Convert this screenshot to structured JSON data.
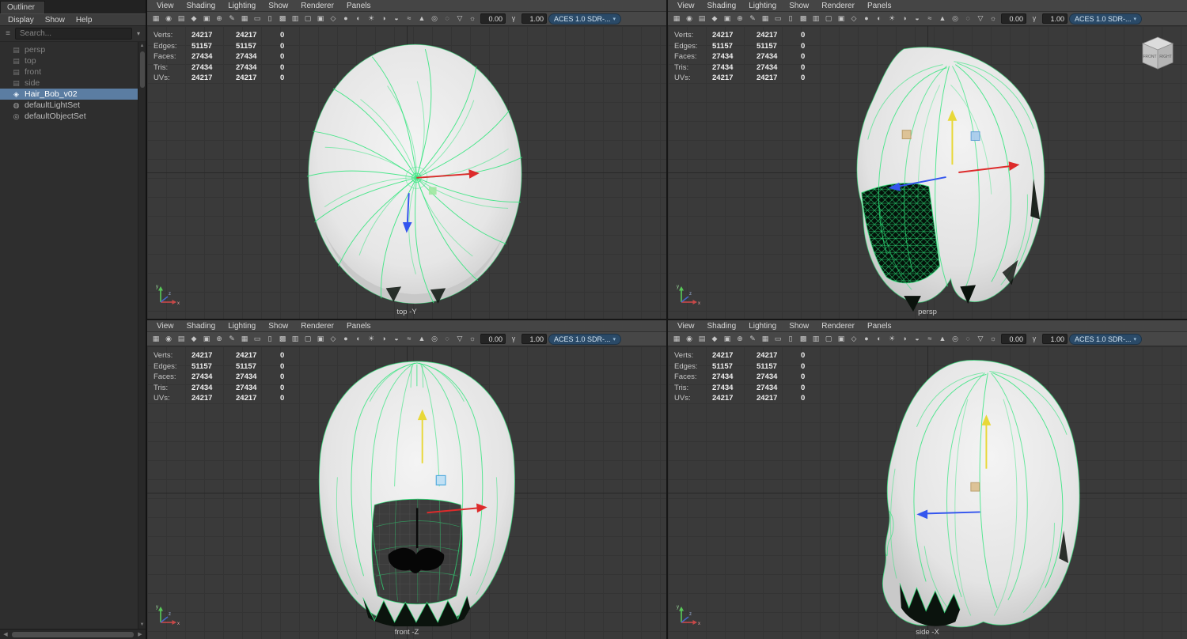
{
  "outliner": {
    "tab_label": "Outliner",
    "menus": [
      "Display",
      "Show",
      "Help"
    ],
    "search_placeholder": "Search...",
    "items": [
      {
        "label": "persp",
        "state": "muted",
        "icon_name": "camera-icon",
        "icon_glyph": "▤"
      },
      {
        "label": "top",
        "state": "muted",
        "icon_name": "camera-icon",
        "icon_glyph": "▤"
      },
      {
        "label": "front",
        "state": "muted",
        "icon_name": "camera-icon",
        "icon_glyph": "▤"
      },
      {
        "label": "side",
        "state": "muted",
        "icon_name": "camera-icon",
        "icon_glyph": "▤"
      },
      {
        "label": "Hair_Bob_v02",
        "state": "selected",
        "icon_name": "mesh-icon",
        "icon_glyph": "◈"
      },
      {
        "label": "defaultLightSet",
        "state": "normal",
        "icon_name": "light-set-icon",
        "icon_glyph": "◍"
      },
      {
        "label": "defaultObjectSet",
        "state": "normal",
        "icon_name": "object-set-icon",
        "icon_glyph": "◎"
      }
    ]
  },
  "viewport_menus": [
    "View",
    "Shading",
    "Lighting",
    "Show",
    "Renderer",
    "Panels"
  ],
  "toolbar": {
    "icons": [
      {
        "name": "select-camera-icon",
        "glyph": "▦",
        "active": true
      },
      {
        "name": "lock-camera-icon",
        "glyph": "◉"
      },
      {
        "name": "camera-attributes-icon",
        "glyph": "▤"
      },
      {
        "name": "bookmark-icon",
        "glyph": "◆"
      },
      {
        "name": "image-plane-icon",
        "glyph": "▣"
      },
      {
        "name": "two-d-pan-zoom-icon",
        "glyph": "⊕"
      },
      {
        "name": "grease-pencil-icon",
        "glyph": "✎"
      },
      {
        "name": "grid-toggle-icon",
        "glyph": "▦"
      },
      {
        "name": "film-gate-icon",
        "glyph": "▭"
      },
      {
        "name": "resolution-gate-icon",
        "glyph": "▯"
      },
      {
        "name": "gate-mask-icon",
        "glyph": "▩"
      },
      {
        "name": "field-chart-icon",
        "glyph": "▥"
      },
      {
        "name": "safe-action-icon",
        "glyph": "▢"
      },
      {
        "name": "safe-title-icon",
        "glyph": "▣"
      },
      {
        "name": "wireframe-icon",
        "glyph": "◇"
      },
      {
        "name": "shaded-mode-icon",
        "glyph": "●"
      },
      {
        "name": "textured-mode-icon",
        "glyph": "◐"
      },
      {
        "name": "use-all-lights-icon",
        "glyph": "☀"
      },
      {
        "name": "shadows-icon",
        "glyph": "◑"
      },
      {
        "name": "ambient-occlusion-icon",
        "glyph": "◒"
      },
      {
        "name": "motion-blur-icon",
        "glyph": "≈"
      },
      {
        "name": "anti-aliasing-icon",
        "glyph": "▲"
      },
      {
        "name": "depth-of-field-icon",
        "glyph": "◎"
      },
      {
        "name": "isolate-select-icon",
        "glyph": "◌"
      },
      {
        "name": "x-ray-icon",
        "glyph": "▽"
      },
      {
        "name": "exposure-icon",
        "glyph": "☼"
      }
    ],
    "exposure_value": "0.00",
    "gamma_icon": "γ",
    "gamma_value": "1.00",
    "view_transform": "ACES 1.0 SDR-..."
  },
  "stats": [
    {
      "label": "Verts:",
      "v1": "24217",
      "v2": "24217",
      "v3": "0"
    },
    {
      "label": "Edges:",
      "v1": "51157",
      "v2": "51157",
      "v3": "0"
    },
    {
      "label": "Faces:",
      "v1": "27434",
      "v2": "27434",
      "v3": "0"
    },
    {
      "label": "Tris:",
      "v1": "27434",
      "v2": "27434",
      "v3": "0"
    },
    {
      "label": "UVs:",
      "v1": "24217",
      "v2": "24217",
      "v3": "0"
    }
  ],
  "axis_gizmo": {
    "x": "x",
    "y": "y",
    "z": "z"
  },
  "viewports": [
    {
      "id": "top",
      "label": "top -Y"
    },
    {
      "id": "persp",
      "label": "persp",
      "viewcube": {
        "front": "FRONT",
        "right": "RIGHT"
      }
    },
    {
      "id": "front",
      "label": "front -Z"
    },
    {
      "id": "side",
      "label": "side -X"
    }
  ],
  "colors": {
    "wireframe_green": "#2ee57a",
    "selection_blue": "#5b7da2",
    "toolbar_active_blue": "#5d87b5"
  }
}
